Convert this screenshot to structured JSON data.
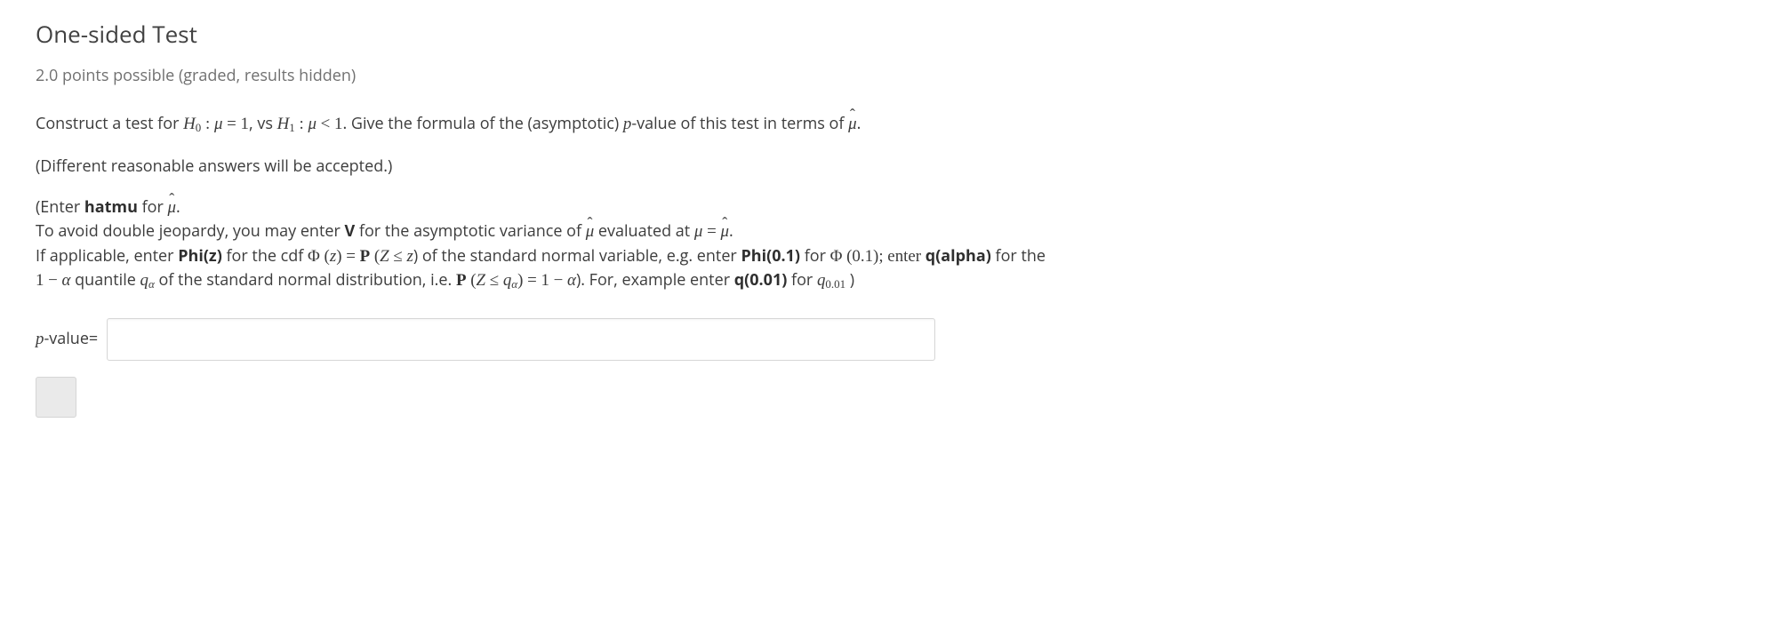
{
  "header": "One-sided Test",
  "progress": "2.0 points possible (graded, results hidden)",
  "para1": {
    "t1": "Construct a test for ",
    "H0": "H",
    "H0sub": "0",
    "t2": " :  ",
    "mu": "μ",
    "eq": " = ",
    "one": "1",
    "t3": ", vs ",
    "H1": "H",
    "H1sub": "1",
    "t4": " :  ",
    "mu2": "μ",
    "lt": " < ",
    "one2": "1",
    "t5": ". Give the formula of the (asymptotic) ",
    "p": "p",
    "t6": "-value of this test in terms of ",
    "muhat": "μ",
    "t7": "."
  },
  "para2": "(Different reasonable answers will be accepted.)",
  "para3": {
    "l1a": "(Enter ",
    "l1b": "hatmu",
    "l1c": " for ",
    "l1mu": "μ",
    "l1d": ".",
    "l2a": "To avoid double jeopardy, you may enter ",
    "l2b": "V",
    "l2c": " for the asymptotic variance of ",
    "l2mu1": "μ",
    "l2d": " evaluated at ",
    "l2mu2": "μ",
    "l2eq": " = ",
    "l2mu3": "μ",
    "l2e": ".",
    "l3a": "If applicable, enter ",
    "l3b": "Phi(z)",
    "l3c": " for the cdf ",
    "l3phi": "Φ",
    "l3d": " (",
    "l3z": "z",
    "l3e": ") = ",
    "l3P": "P",
    "l3f": " (",
    "l3Z": "Z",
    "l3le": " ≤ ",
    "l3z2": "z",
    "l3g": ") of the standard normal variable, e.g. enter ",
    "l3h": "Phi(0.1)",
    "l3i": " for ",
    "l3phi2": "Φ",
    "l3j": " (0.1); enter ",
    "l3k": "q(alpha)",
    "l3l": " for the ",
    "l4a": "1 − ",
    "l4al": "α",
    "l4b": " quantile ",
    "l4q": "q",
    "l4qs": "α",
    "l4c": " of the standard normal distribution, i.e. ",
    "l4P": "P",
    "l4d": " (",
    "l4Z": "Z",
    "l4le": " ≤ ",
    "l4q2": "q",
    "l4qs2": "α",
    "l4e": ") = 1 − ",
    "l4al2": "α",
    "l4f": "). For, example enter ",
    "l4g": "q(0.01)",
    "l4h": " for ",
    "l4q3": "q",
    "l4qs3": "0.01",
    "l4i": " )"
  },
  "answer": {
    "label_p": "p",
    "label_rest": "-value=",
    "value": ""
  }
}
